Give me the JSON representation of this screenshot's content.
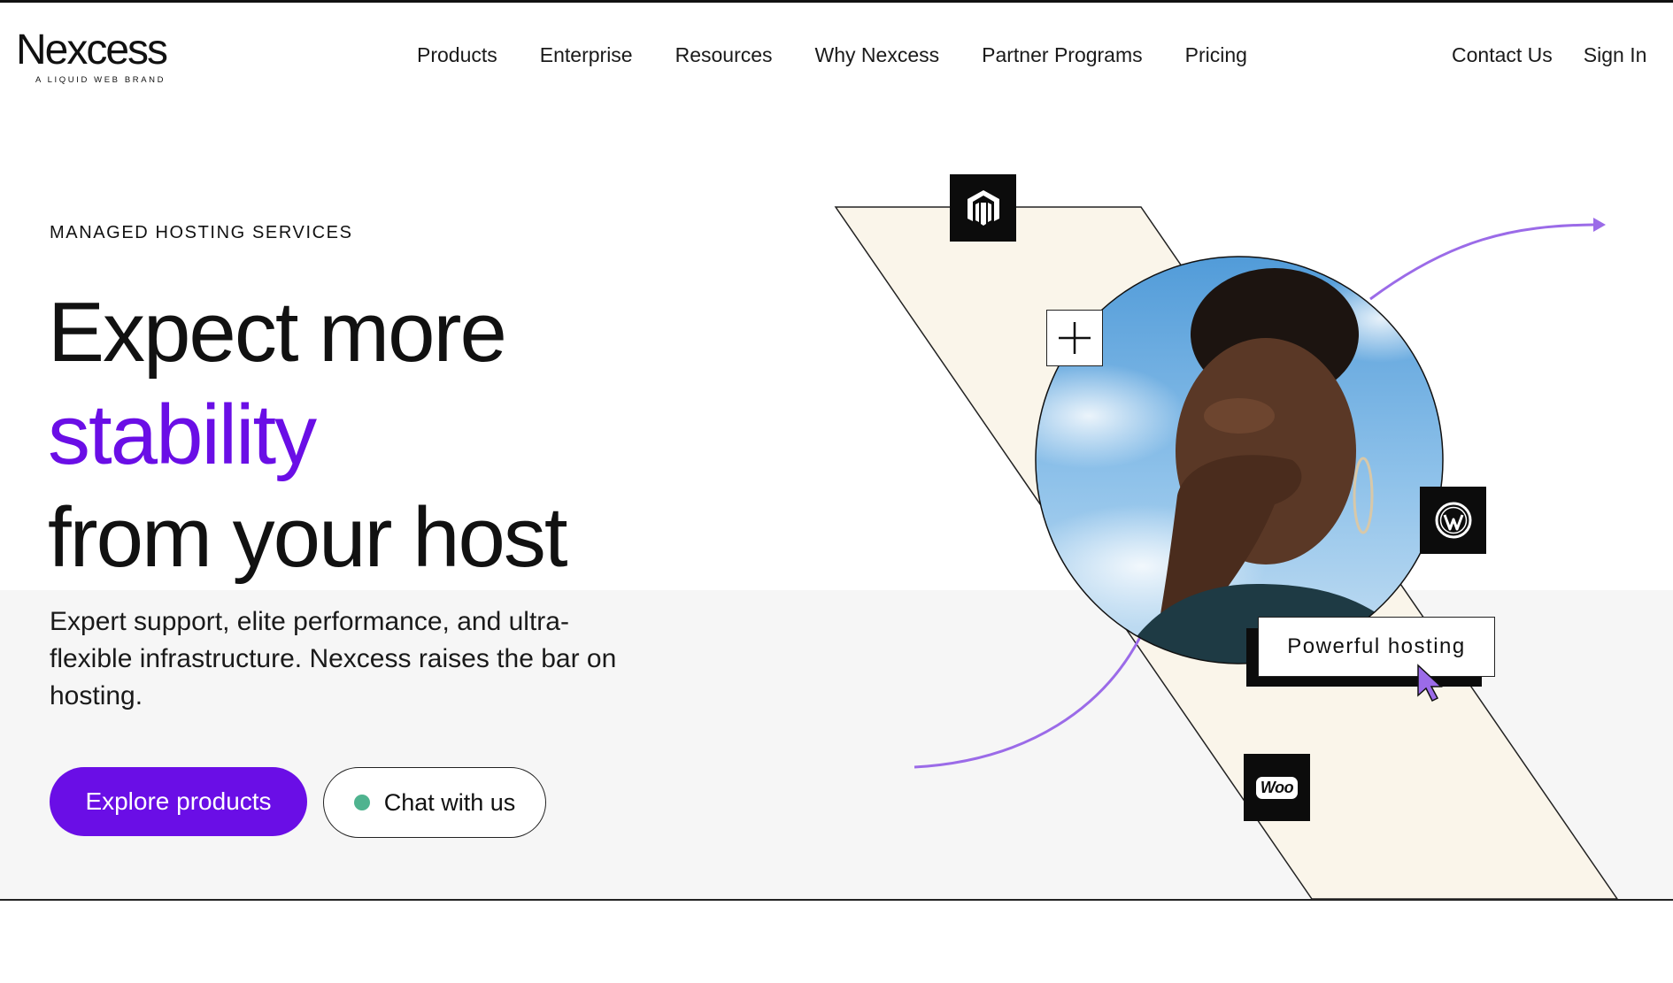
{
  "brand": {
    "name": "Nexcess",
    "tagline": "A LIQUID WEB BRAND"
  },
  "nav": {
    "items": [
      "Products",
      "Enterprise",
      "Resources",
      "Why Nexcess",
      "Partner Programs",
      "Pricing"
    ],
    "contact": "Contact Us",
    "signin": "Sign In"
  },
  "hero": {
    "eyebrow": "MANAGED HOSTING SERVICES",
    "headline_line1": "Expect more",
    "headline_accent": "stability",
    "headline_line3": "from your host",
    "subtext": "Expert support, elite performance, and ultra-flexible infrastructure. Nexcess raises the bar on hosting.",
    "primary_cta": "Explore products",
    "chat_cta": "Chat with us"
  },
  "illustration": {
    "badge_text": "Powerful hosting",
    "icons": [
      "magento-icon",
      "wordpress-icon",
      "woocommerce-icon",
      "plus-icon",
      "cursor-icon"
    ],
    "woo_label": "Woo"
  },
  "colors": {
    "accent": "#6a0ee6",
    "parallelogram": "#faf5ea",
    "curve": "#9b6be8",
    "chat_dot": "#4fb38f",
    "panel": "#f6f6f6"
  }
}
